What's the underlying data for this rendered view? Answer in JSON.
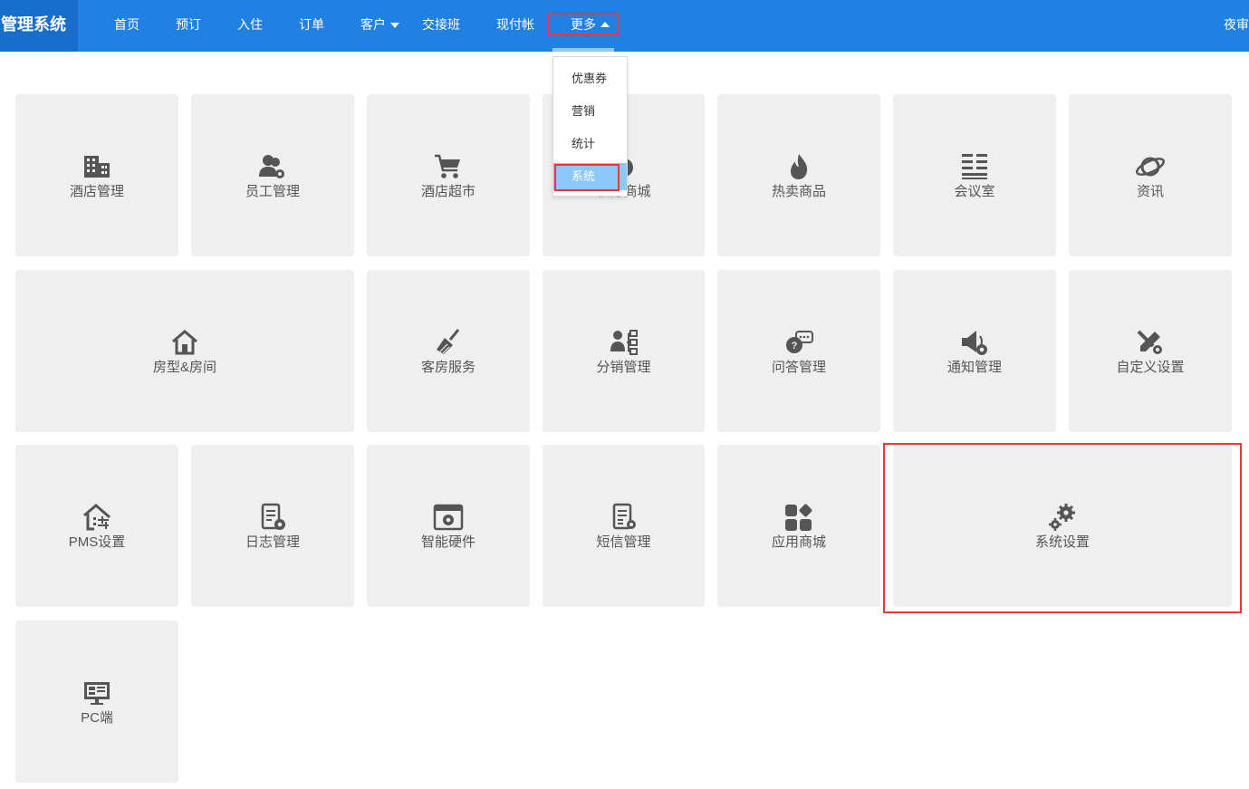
{
  "header": {
    "brand": "管理系统",
    "right_text": "夜审",
    "nav": [
      {
        "label": "首页"
      },
      {
        "label": "预订"
      },
      {
        "label": "入住"
      },
      {
        "label": "订单"
      },
      {
        "label": "客户"
      },
      {
        "label": "交接班"
      },
      {
        "label": "现付帐"
      },
      {
        "label": "更多"
      }
    ]
  },
  "dropdown": {
    "items": [
      {
        "label": "优惠券"
      },
      {
        "label": "营销"
      },
      {
        "label": "统计"
      },
      {
        "label": "系统",
        "active": true
      }
    ]
  },
  "tiles": [
    {
      "label": "酒店管理",
      "icon": "building-icon"
    },
    {
      "label": "员工管理",
      "icon": "staff-icon"
    },
    {
      "label": "酒店超市",
      "icon": "cart-icon"
    },
    {
      "label": "积分商城",
      "icon": "mall-icon"
    },
    {
      "label": "热卖商品",
      "icon": "fire-icon"
    },
    {
      "label": "会议室",
      "icon": "meeting-icon"
    },
    {
      "label": "资讯",
      "icon": "planet-icon"
    },
    {
      "label": "房型&房间",
      "icon": "house-icon"
    },
    {
      "label": "客房服务",
      "icon": "broom-icon"
    },
    {
      "label": "分销管理",
      "icon": "distribution-icon"
    },
    {
      "label": "问答管理",
      "icon": "qa-icon"
    },
    {
      "label": "通知管理",
      "icon": "notice-icon"
    },
    {
      "label": "自定义设置",
      "icon": "custom-icon"
    },
    {
      "label": "PMS设置",
      "icon": "pms-icon"
    },
    {
      "label": "日志管理",
      "icon": "log-icon"
    },
    {
      "label": "智能硬件",
      "icon": "hardware-icon"
    },
    {
      "label": "短信管理",
      "icon": "sms-icon"
    },
    {
      "label": "应用商城",
      "icon": "apps-icon"
    },
    {
      "label": "系统设置",
      "icon": "gears-icon"
    },
    {
      "label": "PC端",
      "icon": "pc-icon"
    }
  ],
  "colors": {
    "header_bg": "#2181e2",
    "brand_bg": "#1a6ecb",
    "tile_bg": "#efefef",
    "icon": "#555555",
    "dropdown_active": "#8cc8fa",
    "highlight": "#e8383d"
  }
}
